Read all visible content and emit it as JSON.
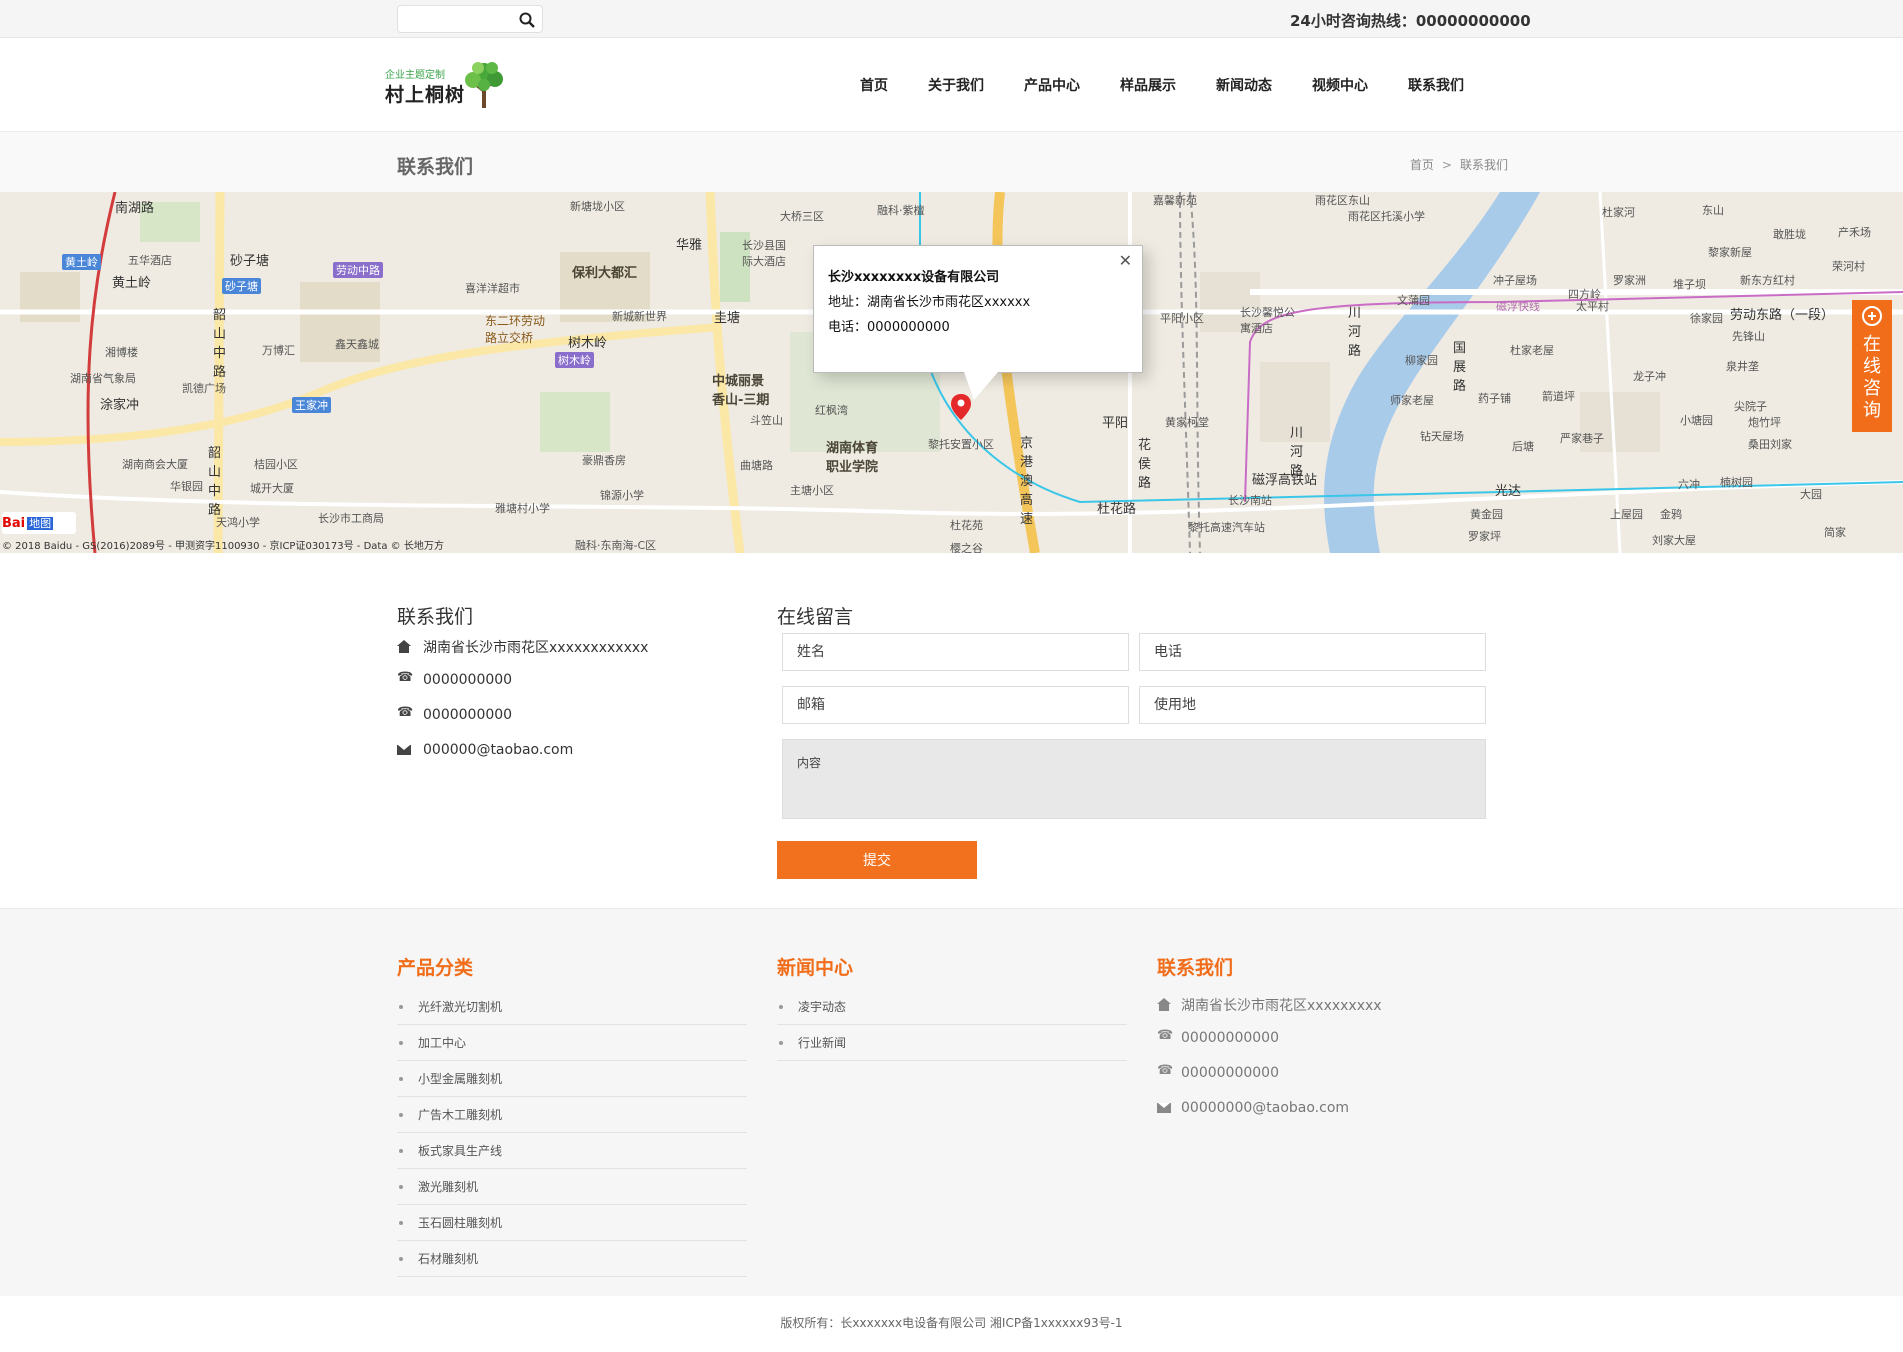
{
  "search": {
    "placeholder": "",
    "icon": "search-icon"
  },
  "hotline": "24小时咨询热线：00000000000",
  "logo": {
    "tagline": "企业主题定制",
    "brand": "村上桐树"
  },
  "nav": [
    {
      "label": "首页"
    },
    {
      "label": "关于我们"
    },
    {
      "label": "产品中心"
    },
    {
      "label": "样品展示"
    },
    {
      "label": "新闻动态"
    },
    {
      "label": "视频中心"
    },
    {
      "label": "联系我们"
    }
  ],
  "page": {
    "title": "联系我们"
  },
  "breadcrumb": {
    "home": "首页",
    "current": "联系我们"
  },
  "map": {
    "info": {
      "company": "长沙xxxxxxxx设备有限公司",
      "address": "地址：湖南省长沙市雨花区xxxxxx",
      "phone": "电话：0000000000"
    },
    "copyright": "© 2018 Baidu - GS(2016)2089号 - 甲测资字1100930 - 京ICP证030173号 - Data © 长地万方",
    "logo_text": "Bai",
    "logo_badge": "地图",
    "labels": {
      "l1": "南湖路",
      "l2": "黄土岭",
      "l3": "黄土岭",
      "l4": "砂子塘",
      "l5": "砂子塘",
      "l6": "五华酒店",
      "l7": "劳动中路",
      "l8": "保利大都汇",
      "l9": "华雅",
      "l10": "圭塘",
      "l11": "东二环劳动路立交桥",
      "l12": "树木岭",
      "l13": "树木岭",
      "l14": "中城丽景香山-三期",
      "l15": "湖南体育职业学院",
      "l16": "韶山中路",
      "l17": "韶山中路",
      "l18": "涂家冲",
      "l19": "王家冲",
      "l20": "湘博楼",
      "l21": "湖南省气象局",
      "l22": "京港澳高速",
      "l23": "平阳",
      "l24": "花侯路",
      "l25": "杜花路",
      "l26": "磁浮高铁站",
      "l27": "光达",
      "l28": "劳动东路（一段）",
      "l29": "川河路",
      "l30": "国展路",
      "l31": "川河路",
      "l32": "红枫湾",
      "l33": "黎托安置小区",
      "l34": "曲塘路",
      "l35": "湖南商会大厦",
      "l36": "大桥三区",
      "l37": "融科·紫檀",
      "l38": "雨花区东山",
      "l39": "雨花区托溪小学",
      "l40": "杜家河",
      "l41": "东山",
      "l42": "文蒲园",
      "l43": "磁浮快线",
      "l44": "太平村",
      "l45": "新塘垅小区",
      "l46": "长沙县国际大酒店",
      "l47": "万博汇",
      "l48": "凯德广场",
      "l49": "桔园小区",
      "l50": "华银园",
      "l51": "城开大厦",
      "l52": "天鸿小学",
      "l53": "长沙市工商局",
      "l54": "雅塘村小学",
      "l55": "锦源小学",
      "l56": "融科·东南海-C区",
      "l57": "杜花苑",
      "l58": "樱之谷",
      "l59": "黎托高速汽车站",
      "l60": "长沙南站",
      "l61": "柳家园",
      "l62": "师家老屋",
      "l63": "药子铺",
      "l64": "箭道坪",
      "l65": "龙子冲",
      "l66": "小塘园",
      "l67": "泉井垄",
      "l68": "尖院子",
      "l69": "炮竹坪",
      "l70": "桑田刘家",
      "l71": "徐家园",
      "l72": "先锋山",
      "l73": "杜家老屋",
      "l74": "四方岭",
      "l75": "罗家洲",
      "l76": "堆子坝",
      "l77": "新东方红村",
      "l78": "敢胜垅",
      "l79": "产禾场",
      "l80": "黎家新屋",
      "l81": "荣河村",
      "l82": "冲子屋场",
      "l83": "钻天屋场",
      "l84": "后塘",
      "l85": "严家巷子",
      "l86": "六冲",
      "l87": "楠树园",
      "l88": "大园",
      "l89": "黄金园",
      "l90": "罗家坪",
      "l91": "上屋园",
      "l92": "金鸦",
      "l93": "刘家大屋",
      "l94": "简家",
      "l95": "喜洋洋超市",
      "l96": "鑫天鑫城",
      "l97": "新城新世界",
      "l98": "斗笠山",
      "l99": "豪鼎香房",
      "l100": "主塘小区",
      "l101": "长沙馨悦公寓酒店",
      "l102": "平阳小区",
      "l103": "黄家柯堂",
      "l104": "嘉馨新苑"
    }
  },
  "contact": {
    "title": "联系我们",
    "address": "湖南省长沙市雨花区xxxxxxxxxxxx",
    "phone1": "0000000000",
    "phone2": "0000000000",
    "email": "000000@taobao.com"
  },
  "form": {
    "title": "在线留言",
    "name_placeholder": "姓名",
    "phone_placeholder": "电话",
    "email_placeholder": "邮箱",
    "region_placeholder": "使用地",
    "content_placeholder": "内容",
    "submit_label": "提交"
  },
  "consult": {
    "label": "在线咨询"
  },
  "footer": {
    "products": {
      "title": "产品分类",
      "items": [
        "光纤激光切割机",
        "加工中心",
        "小型金属雕刻机",
        "广告木工雕刻机",
        "板式家具生产线",
        "激光雕刻机",
        "玉石圆柱雕刻机",
        "石材雕刻机"
      ]
    },
    "news": {
      "title": "新闻中心",
      "items": [
        "凌宇动态",
        "行业新闻"
      ]
    },
    "contact": {
      "title": "联系我们",
      "address": "湖南省长沙市雨花区xxxxxxxxx",
      "phone1": "00000000000",
      "phone2": "00000000000",
      "email": "00000000@taobao.com"
    },
    "copyright": "版权所有：长xxxxxxx电设备有限公司 湘ICP备1xxxxxx93号-1"
  },
  "colors": {
    "accent": "#f16d1a",
    "button": "#f1711e"
  }
}
